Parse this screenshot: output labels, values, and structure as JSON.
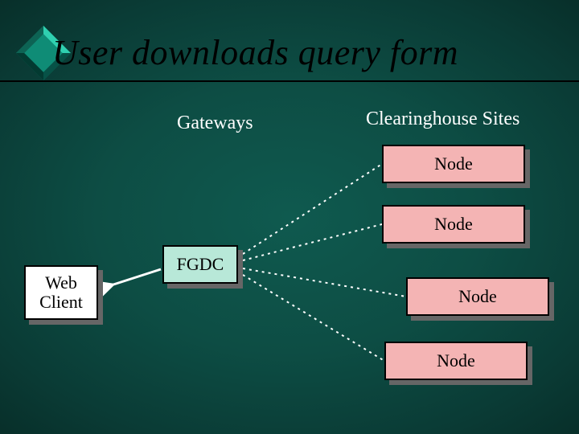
{
  "title": "User downloads query form",
  "columns": {
    "gateways": "Gateways",
    "clearinghouse": "Clearinghouse Sites"
  },
  "boxes": {
    "web_client_line1": "Web",
    "web_client_line2": "Client",
    "fgdc": "FGDC",
    "node1": "Node",
    "node2": "Node",
    "node3": "Node",
    "node4": "Node"
  },
  "colors": {
    "node_fill": "#f4b4b4",
    "fgdc_fill": "#b8e8d8",
    "web_fill": "#ffffff",
    "diamond_light": "#2fd0b0",
    "diamond_mid": "#0a7a66",
    "diamond_dark": "#033a31"
  }
}
